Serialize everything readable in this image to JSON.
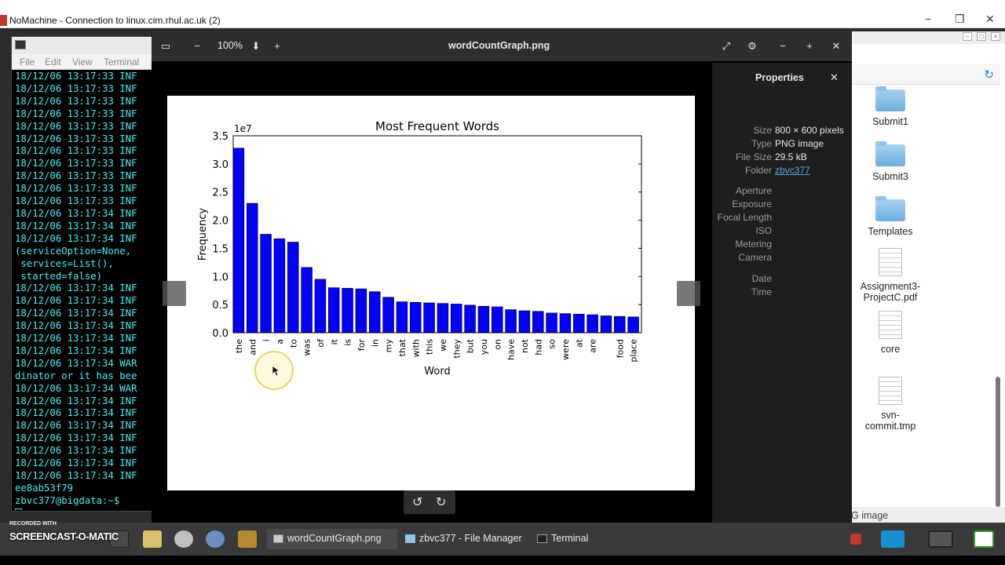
{
  "outer_window": {
    "title": "NoMachine - Connection to linux.cim.rhul.ac.uk (2)",
    "minimize": "−",
    "restore": "❐",
    "close": "✕"
  },
  "terminal": {
    "menu": [
      "File",
      "Edit",
      "View",
      "Terminal"
    ],
    "lines": [
      "18/12/06 13:17:33 INF",
      "18/12/06 13:17:33 INF",
      "18/12/06 13:17:33 INF",
      "18/12/06 13:17:33 INF",
      "18/12/06 13:17:33 INF",
      "18/12/06 13:17:33 INF",
      "18/12/06 13:17:33 INF",
      "18/12/06 13:17:33 INF",
      "18/12/06 13:17:33 INF",
      "18/12/06 13:17:33 INF",
      "18/12/06 13:17:33 INF",
      "18/12/06 13:17:34 INF",
      "18/12/06 13:17:34 INF",
      "18/12/06 13:17:34 INF",
      "(serviceOption=None,",
      " services=List(),",
      " started=false)",
      "18/12/06 13:17:34 INF",
      "18/12/06 13:17:34 INF",
      "18/12/06 13:17:34 INF",
      "18/12/06 13:17:34 INF",
      "18/12/06 13:17:34 INF",
      "18/12/06 13:17:34 INF",
      "18/12/06 13:17:34 WAR",
      "dinator or it has bee",
      "18/12/06 13:17:34 WAR",
      "18/12/06 13:17:34 INF",
      "18/12/06 13:17:34 INF",
      "18/12/06 13:17:34 INF",
      "18/12/06 13:17:34 INF",
      "18/12/06 13:17:34 INF",
      "18/12/06 13:17:34 INF",
      "18/12/06 13:17:34 INF",
      "ee8ab53f79",
      "zbvc377@bigdata:~$ "
    ]
  },
  "viewer": {
    "zoom": "100%",
    "title": "wordCountGraph.png",
    "buttons": {
      "sidebar": "▭",
      "zoom_out": "−",
      "zoom_in": "+",
      "download": "⬇",
      "fullscreen": "⤢",
      "settings": "⚙",
      "minimize": "−",
      "maximize": "+",
      "close": "✕"
    },
    "rotate_left": "↺",
    "rotate_right": "↻"
  },
  "properties": {
    "title": "Properties",
    "close": "✕",
    "rows": [
      {
        "label": "Size",
        "value": "800 × 600 pixels"
      },
      {
        "label": "Type",
        "value": "PNG image"
      },
      {
        "label": "File Size",
        "value": "29.5 kB"
      },
      {
        "label": "Folder",
        "value": "zbvc377"
      },
      {
        "label": "Aperture",
        "value": ""
      },
      {
        "label": "Exposure",
        "value": ""
      },
      {
        "label": "Focal Length",
        "value": ""
      },
      {
        "label": "ISO",
        "value": ""
      },
      {
        "label": "Metering",
        "value": ""
      },
      {
        "label": "Camera",
        "value": ""
      },
      {
        "label": "Date",
        "value": ""
      },
      {
        "label": "Time",
        "value": ""
      }
    ]
  },
  "file_manager": {
    "items": [
      {
        "name": "Submit1",
        "kind": "folder"
      },
      {
        "name": "Submit3",
        "kind": "folder"
      },
      {
        "name": "Templates",
        "kind": "folder"
      },
      {
        "name": "Assignment3-ProjectC.pdf",
        "kind": "file"
      },
      {
        "name": "core",
        "kind": "file"
      },
      {
        "name": "svn-commit.tmp",
        "kind": "file"
      }
    ],
    "status": "G image",
    "refresh_icon": "refresh-icon"
  },
  "chart_data": {
    "type": "bar",
    "title": "Most Frequent Words",
    "xlabel": "Word",
    "ylabel": "Frequency",
    "offset_label": "1e7",
    "ylim": [
      0,
      3.5
    ],
    "yticks": [
      "0.0",
      "0.5",
      "1.0",
      "1.5",
      "2.0",
      "2.5",
      "3.0",
      "3.5"
    ],
    "categories": [
      "the",
      "and",
      "i",
      "a",
      "to",
      "was",
      "of",
      "it",
      "is",
      "for",
      "in",
      "my",
      "that",
      "with",
      "this",
      "we",
      "they",
      "but",
      "you",
      "on",
      "have",
      "not",
      "had",
      "so",
      "were",
      "at",
      "are",
      "",
      "food",
      "place"
    ],
    "values": [
      3.28,
      2.3,
      1.75,
      1.67,
      1.61,
      1.16,
      0.95,
      0.8,
      0.79,
      0.78,
      0.73,
      0.63,
      0.55,
      0.54,
      0.53,
      0.52,
      0.51,
      0.49,
      0.47,
      0.46,
      0.41,
      0.39,
      0.38,
      0.35,
      0.34,
      0.33,
      0.32,
      0.3,
      0.29,
      0.28
    ],
    "bar_color": "#0000ff",
    "grid": false
  },
  "taskbar": {
    "watermark_small": "RECORDED WITH",
    "watermark_big": "SCREENCAST-O-MATIC",
    "tasks": [
      {
        "label": "wordCountGraph.png",
        "icon": "image-icon"
      },
      {
        "label": "zbvc377 - File Manager",
        "icon": "folder-icon"
      },
      {
        "label": "Terminal",
        "icon": "terminal-icon"
      }
    ],
    "accent": "#1a8fd0"
  }
}
